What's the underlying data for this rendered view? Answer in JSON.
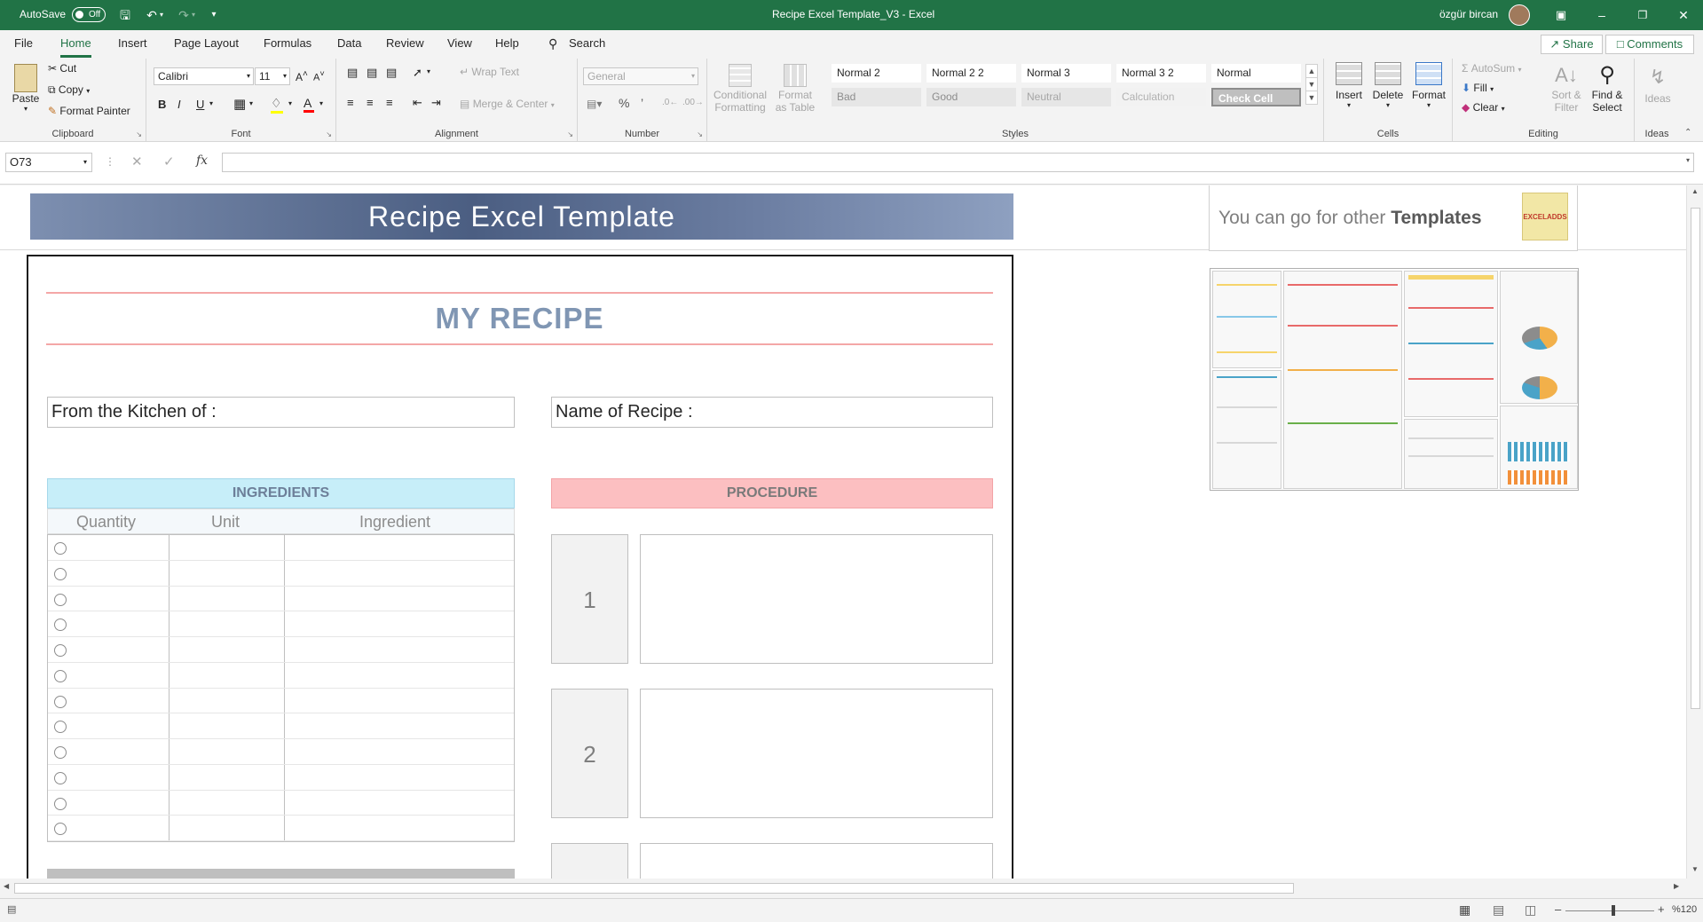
{
  "titlebar": {
    "autosave_label": "AutoSave",
    "autosave_state": "Off",
    "document_title": "Recipe Excel Template_V3  -  Excel",
    "user_name": "özgür bircan"
  },
  "menu": {
    "tabs": [
      "File",
      "Home",
      "Insert",
      "Page Layout",
      "Formulas",
      "Data",
      "Review",
      "View",
      "Help"
    ],
    "search_label": "Search",
    "share_label": "Share",
    "comments_label": "Comments"
  },
  "ribbon": {
    "clipboard": {
      "paste": "Paste",
      "cut": "Cut",
      "copy": "Copy",
      "format_painter": "Format Painter",
      "label": "Clipboard"
    },
    "font": {
      "name": "Calibri",
      "size": "11",
      "label": "Font"
    },
    "alignment": {
      "wrap_text": "Wrap Text",
      "merge_center": "Merge & Center",
      "label": "Alignment"
    },
    "number": {
      "format": "General",
      "label": "Number"
    },
    "styles": {
      "conditional_formatting": "Conditional Formatting",
      "format_as_table": "Format as Table",
      "cells": [
        {
          "label": "Normal 2",
          "bg": "#ffffff",
          "fg": "#262626"
        },
        {
          "label": "Normal 2 2",
          "bg": "#ffffff",
          "fg": "#262626"
        },
        {
          "label": "Normal 3",
          "bg": "#ffffff",
          "fg": "#262626"
        },
        {
          "label": "Normal 3 2",
          "bg": "#ffffff",
          "fg": "#262626"
        },
        {
          "label": "Normal",
          "bg": "#ffffff",
          "fg": "#262626"
        },
        {
          "label": "Bad",
          "bg": "#e6e6e6",
          "fg": "#8c8c8c"
        },
        {
          "label": "Good",
          "bg": "#e6e6e6",
          "fg": "#8c8c8c"
        },
        {
          "label": "Neutral",
          "bg": "#e6e6e6",
          "fg": "#a6a6a6"
        },
        {
          "label": "Calculation",
          "bg": "#f2f2f2",
          "fg": "#b0b0b0"
        },
        {
          "label": "Check Cell",
          "bg": "#bfbfbf",
          "fg": "#ffffff"
        }
      ],
      "label": "Styles"
    },
    "cells": {
      "insert": "Insert",
      "delete": "Delete",
      "format": "Format",
      "label": "Cells"
    },
    "editing": {
      "autosum": "AutoSum",
      "fill": "Fill",
      "clear": "Clear",
      "sort_filter": "Sort & Filter",
      "find_select": "Find & Select",
      "label": "Editing"
    },
    "ideas": {
      "ideas": "Ideas",
      "label": "Ideas"
    }
  },
  "formula_bar": {
    "name_box": "O73",
    "fx": "fx",
    "formula": ""
  },
  "sheet": {
    "banner_title": "Recipe Excel Template",
    "heading": "MY RECIPE",
    "kitchen_label": "From the Kitchen of :",
    "recipe_name_label": "Name of Recipe :",
    "ingredients": {
      "title": "INGREDIENTS",
      "columns": [
        "Quantity",
        "Unit",
        "Ingredient"
      ],
      "row_count": 12
    },
    "procedure": {
      "title": "PROCEDURE",
      "steps": [
        "1",
        "2"
      ]
    },
    "promo": {
      "text_plain": "You can go for other ",
      "text_bold": "Templates",
      "logo": "EXCELADDS"
    }
  },
  "status": {
    "zoom": "%120"
  },
  "colors": {
    "excel_green": "#217346",
    "ingredients_header": "#c7eef9",
    "procedure_header": "#fcbfc1",
    "title_accent": "#8096b3",
    "rule_pink": "#f4a7a7"
  }
}
